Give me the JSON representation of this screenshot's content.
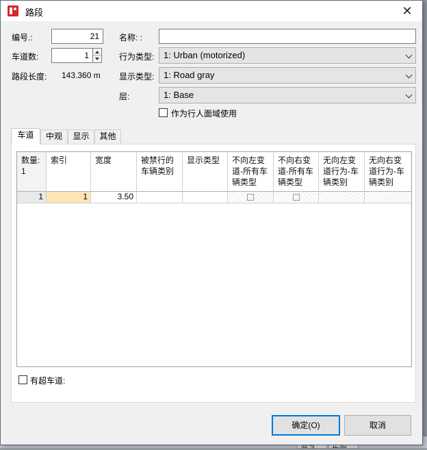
{
  "dialog": {
    "title": "路段",
    "close_glyph": "✕"
  },
  "form": {
    "id_label": "编号.:",
    "id_value": "21",
    "lanes_label": "车道数:",
    "lanes_value": "1",
    "length_label": "路段长度:",
    "length_value": "143.360 m",
    "name_label": "名称: :",
    "name_value": "",
    "behavior_label": "行为类型:",
    "behavior_value": "1: Urban (motorized)",
    "display_label": "显示类型:",
    "display_value": "1: Road gray",
    "level_label": "层:",
    "level_value": "1: Base",
    "pedestrian_label": "作为行人面域使用",
    "pedestrian_checked": false
  },
  "tabs": [
    {
      "label": "车道",
      "active": true
    },
    {
      "label": "中观",
      "active": false
    },
    {
      "label": "显示",
      "active": false
    },
    {
      "label": "其他",
      "active": false
    }
  ],
  "lanes_table": {
    "headers": [
      "数量: 1",
      "索引",
      "宽度",
      "被禁行的车辆类别",
      "显示类型",
      "不向左变道-所有车辆类型",
      "不向右变道-所有车辆类型",
      "无向左变道行为-车辆类别",
      "无向右变道行为-车辆类别"
    ],
    "rows": [
      {
        "num": "1",
        "index": "1",
        "width": "3.50",
        "blocked": "",
        "display": "",
        "no_left_all": false,
        "no_right_all": false,
        "no_left_class": "",
        "no_right_class": ""
      }
    ]
  },
  "overtaking_label": "有超车道:",
  "overtaking_checked": false,
  "buttons": {
    "ok_label": "确定(O)",
    "cancel_label": "取消"
  },
  "background": {
    "cell1": "信号",
    "cell2": "正态"
  }
}
